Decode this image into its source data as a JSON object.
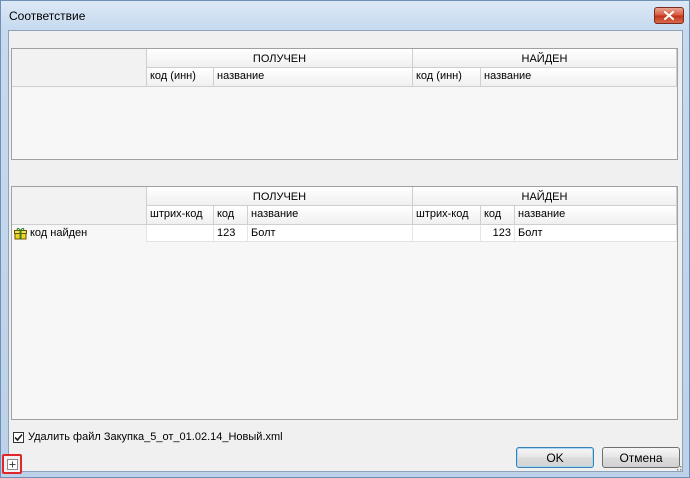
{
  "window": {
    "title": "Соответствие",
    "close_icon": "close-icon"
  },
  "grid_top": {
    "groups": [
      "ПОЛУЧЕН",
      "НАЙДЕН"
    ],
    "received_columns": [
      "код (инн)",
      "название"
    ],
    "found_columns": [
      "код (инн)",
      "название"
    ],
    "rows": []
  },
  "grid_bottom": {
    "groups": [
      "ПОЛУЧЕН",
      "НАЙДЕН"
    ],
    "received_columns": [
      "штрих-код",
      "код",
      "название"
    ],
    "found_columns": [
      "штрих-код",
      "код",
      "название"
    ],
    "rows": [
      {
        "status": "код найден",
        "status_icon": "gift-icon",
        "received_barcode": "",
        "received_code": "123",
        "received_name": "Болт",
        "found_barcode": "",
        "found_code": "123",
        "found_name": "Болт"
      }
    ]
  },
  "delete_file": {
    "checked": true,
    "label": "Удалить файл Закупка_5_от_01.02.14_Новый.xml"
  },
  "buttons": {
    "ok": "OK",
    "cancel": "Отмена"
  },
  "footer": {
    "expand_icon": "plus-expand-icon"
  }
}
